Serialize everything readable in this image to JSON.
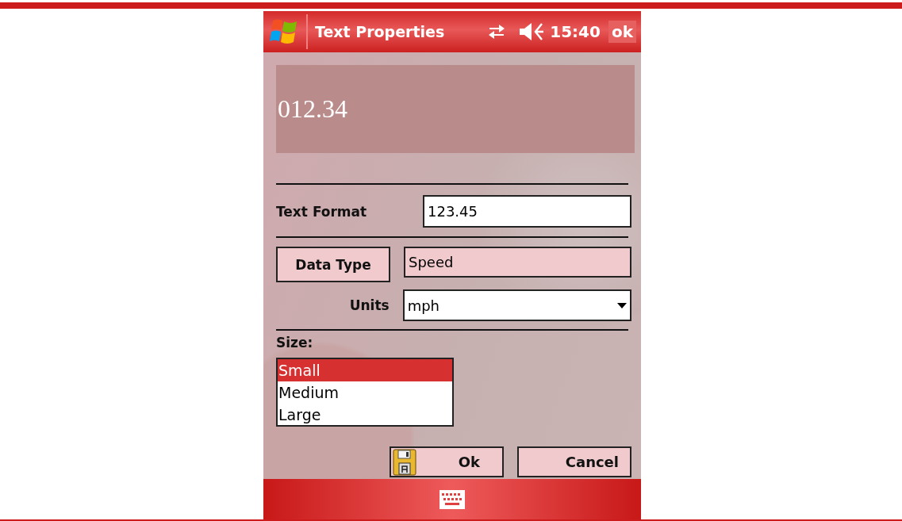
{
  "title_bar": {
    "title": "Text Properties",
    "time": "15:40",
    "ok_button": "ok"
  },
  "preview": {
    "value": "012.34"
  },
  "text_format": {
    "label": "Text Format",
    "value": "123.45"
  },
  "data_type": {
    "button": "Data Type",
    "value": "Speed"
  },
  "units": {
    "label": "Units",
    "value": "mph"
  },
  "size": {
    "label": "Size:",
    "options": [
      {
        "label": "Small",
        "selected": true
      },
      {
        "label": "Medium",
        "selected": false
      },
      {
        "label": "Large",
        "selected": false
      }
    ]
  },
  "buttons": [
    {
      "label": "Ok",
      "kind": "save"
    },
    {
      "label": "Cancel",
      "kind": "plain"
    }
  ]
}
